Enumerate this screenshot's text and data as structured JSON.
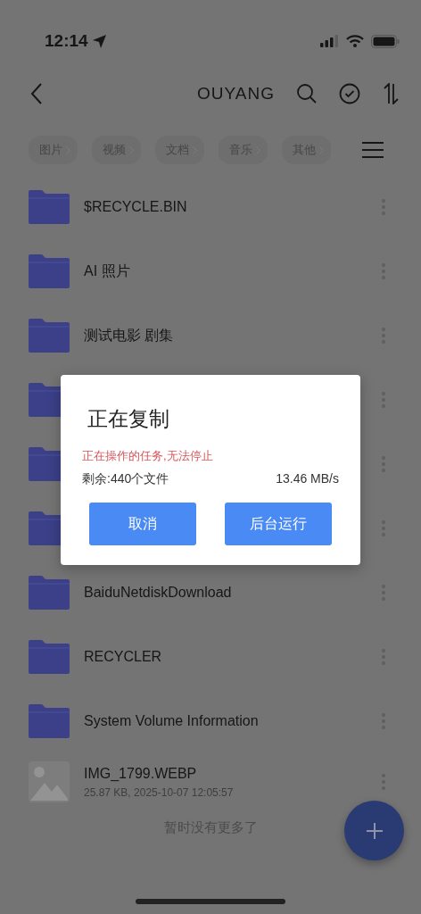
{
  "status_bar": {
    "time": "12:14"
  },
  "header": {
    "title": "OUYANG"
  },
  "filters": [
    {
      "label": "图片"
    },
    {
      "label": "视频"
    },
    {
      "label": "文档"
    },
    {
      "label": "音乐"
    },
    {
      "label": "其他"
    }
  ],
  "files": [
    {
      "kind": "folder",
      "name": "$RECYCLE.BIN"
    },
    {
      "kind": "folder",
      "name": "AI 照片"
    },
    {
      "kind": "folder",
      "name": "测试电影 剧集"
    },
    {
      "kind": "folder"
    },
    {
      "kind": "folder"
    },
    {
      "kind": "folder"
    },
    {
      "kind": "folder",
      "name": "BaiduNetdiskDownload"
    },
    {
      "kind": "folder",
      "name": "RECYCLER"
    },
    {
      "kind": "folder",
      "name": "System Volume Information"
    },
    {
      "kind": "image",
      "name": "IMG_1799.WEBP",
      "details": "25.87 KB, 2025-10-07 12:05:57"
    }
  ],
  "end_note": "暂时没有更多了",
  "dialog": {
    "title": "正在复制",
    "warning": "正在操作的任务,无法停止",
    "remaining": "剩余:440个文件",
    "speed": "13.46 MB/s",
    "buttons": [
      "取消",
      "后台运行"
    ]
  }
}
